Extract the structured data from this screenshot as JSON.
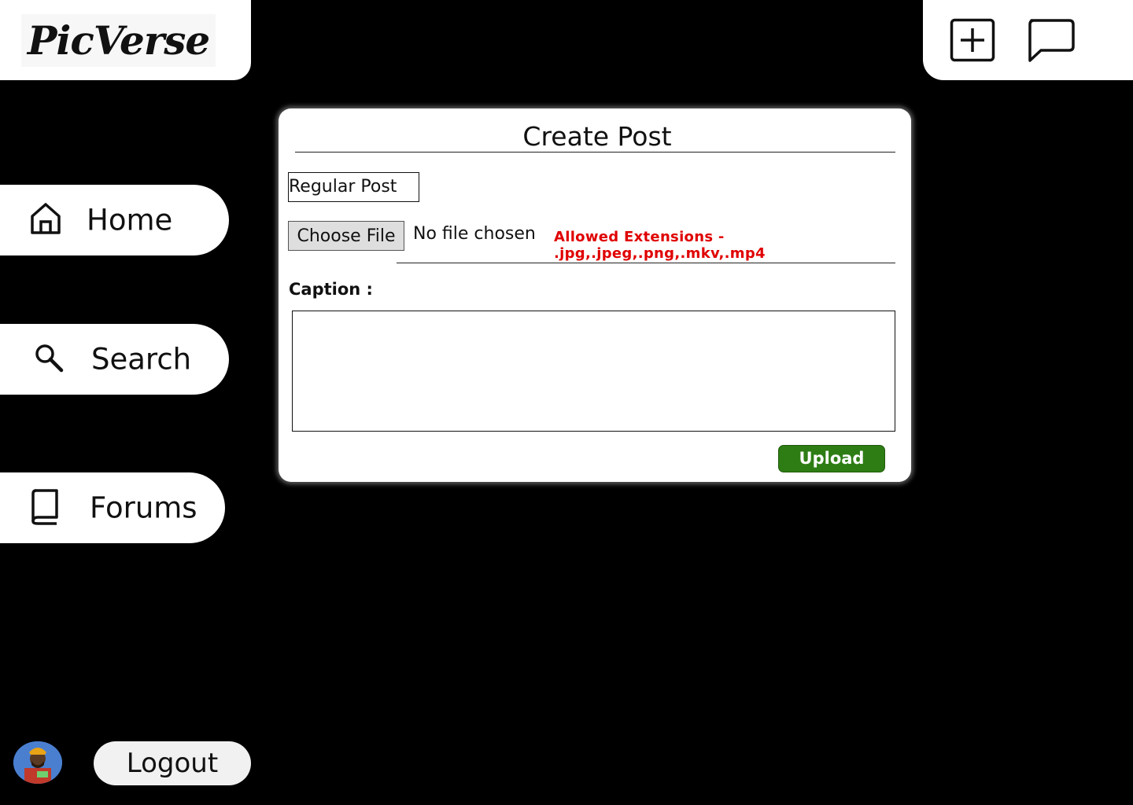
{
  "brand": {
    "logo_text": "PicVerse"
  },
  "top_actions": {
    "add_icon": "plus-square-icon",
    "chat_icon": "chat-bubble-icon"
  },
  "sidebar": {
    "items": [
      {
        "label": "Home",
        "icon": "home-icon"
      },
      {
        "label": "Search",
        "icon": "search-icon"
      },
      {
        "label": "Forums",
        "icon": "book-icon"
      }
    ]
  },
  "user": {
    "logout_label": "Logout"
  },
  "create_post": {
    "title": "Create Post",
    "post_type_selected": "Regular Post",
    "post_type_options": [
      "Regular Post"
    ],
    "choose_file_label": "Choose File",
    "file_status": "No file chosen",
    "allowed_extensions": "Allowed Extensions - .jpg,.jpeg,.png,.mkv,.mp4",
    "caption_label": "Caption :",
    "caption_value": "",
    "upload_label": "Upload"
  },
  "colors": {
    "background": "#000000",
    "panel": "#ffffff",
    "upload_button": "#2e7d14",
    "warning_text": "#e00000"
  }
}
